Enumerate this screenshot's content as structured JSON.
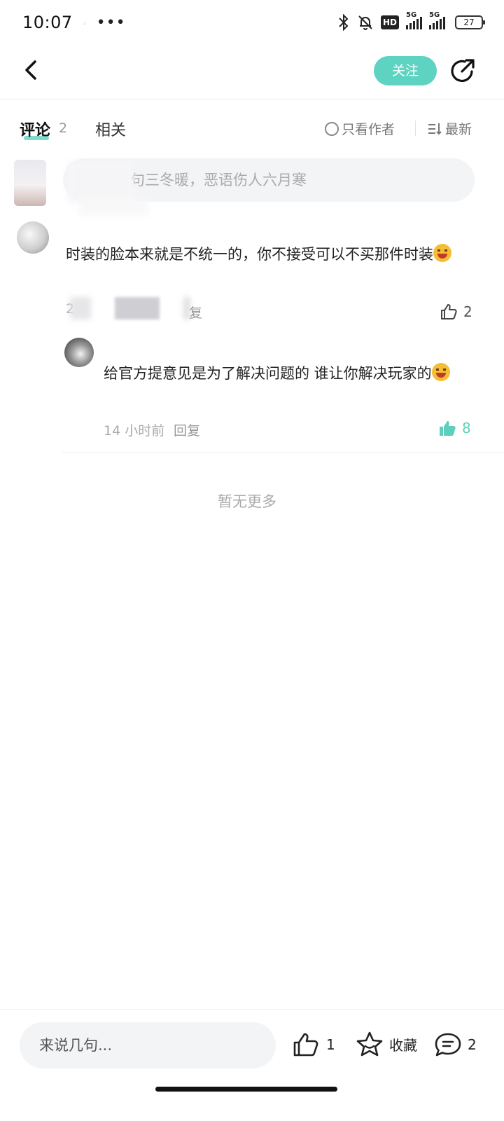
{
  "status_bar": {
    "time": "10:07",
    "more": "•••",
    "hd": "HD",
    "signal1_label": "5G",
    "signal2_label": "5G",
    "battery": "27"
  },
  "header": {
    "follow_label": "关注"
  },
  "tabs": {
    "comments_label": "评论",
    "comments_count": "2",
    "related_label": "相关",
    "author_only_label": "只看作者",
    "sort_label": "最新"
  },
  "quote_bubble": {
    "text": "句三冬暖，恶语伤人六月寒"
  },
  "comment": {
    "text": "时装的脸本来就是不统一的，你不接受可以不买那件时装",
    "meta_prefix": "2",
    "reply_label": "复",
    "likes": "2"
  },
  "reply": {
    "text": "给官方提意见是为了解决问题的 谁让你解决玩家的",
    "time": "14 小时前",
    "reply_label": "回复",
    "likes": "8"
  },
  "list_end": {
    "text": "暂无更多"
  },
  "bottom_bar": {
    "input_placeholder": "来说几句...",
    "likes": "1",
    "favorite_label": "收藏",
    "comments": "2"
  },
  "colors": {
    "accent": "#5ed3c1",
    "liked": "#5ecfbd",
    "muted_text": "#aaaaaa"
  }
}
